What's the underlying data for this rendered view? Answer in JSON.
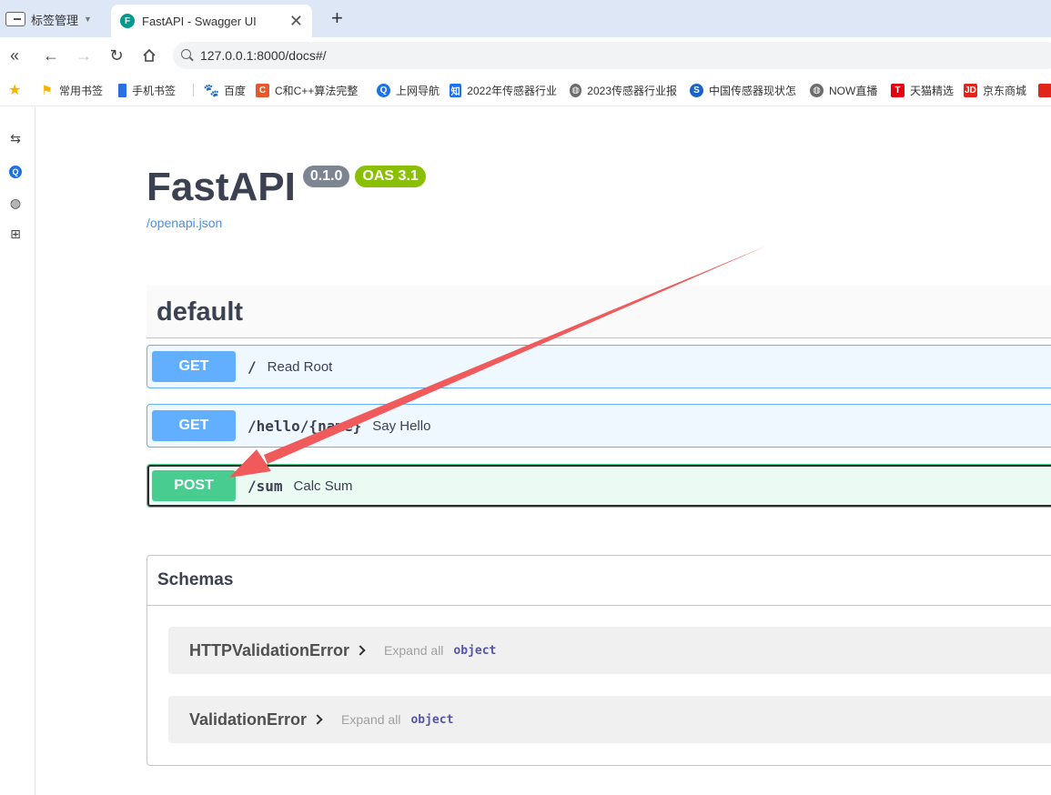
{
  "browser": {
    "tab_manager_label": "标签管理",
    "active_tab_title": "FastAPI - Swagger UI",
    "favicon_letter": "F",
    "address_url": "127.0.0.1:8000/docs#/",
    "bookmarks": [
      {
        "label": "常用书签",
        "icon": "bookmark-icon",
        "color": "#f5b400"
      },
      {
        "label": "手机书签",
        "icon": "phone-icon",
        "color": "#2b6de2"
      },
      {
        "label": "百度",
        "icon": "baidu-icon",
        "color": "#2932e1"
      },
      {
        "label": "C和C++算法完整",
        "icon": "c-icon",
        "color": "#e8572b"
      },
      {
        "label": "上网导航",
        "icon": "q-icon",
        "color": "#1f6fe5"
      },
      {
        "label": "2022年传感器行业",
        "icon": "zhi-icon",
        "color": "#1772f6"
      },
      {
        "label": "2023传感器行业报",
        "icon": "globe-icon",
        "color": "#6b6b6b"
      },
      {
        "label": "中国传感器现状怎",
        "icon": "s-icon",
        "color": "#1a61c8"
      },
      {
        "label": "NOW直播",
        "icon": "globe-icon",
        "color": "#6b6b6b"
      },
      {
        "label": "天猫精选",
        "icon": "tmall-icon",
        "color": "#e40012"
      },
      {
        "label": "京东商城",
        "icon": "jd-icon",
        "color": "#e1251b"
      }
    ]
  },
  "swagger": {
    "title": "FastAPI",
    "version_badge": "0.1.0",
    "oas_badge": "OAS 3.1",
    "spec_link": "/openapi.json",
    "tag": "default",
    "operations": [
      {
        "method": "GET",
        "path": "/",
        "summary": "Read Root"
      },
      {
        "method": "GET",
        "path": "/hello/{name}",
        "summary": "Say Hello"
      },
      {
        "method": "POST",
        "path": "/sum",
        "summary": "Calc Sum"
      }
    ],
    "schemas_title": "Schemas",
    "models": [
      {
        "name": "HTTPValidationError",
        "expand": "Expand all",
        "type": "object"
      },
      {
        "name": "ValidationError",
        "expand": "Expand all",
        "type": "object"
      }
    ]
  },
  "colors": {
    "get": "#61affe",
    "post": "#49cc90",
    "annotation_arrow": "#f05a5a",
    "oas_badge": "#89bf04",
    "version_badge": "#7d8492"
  }
}
